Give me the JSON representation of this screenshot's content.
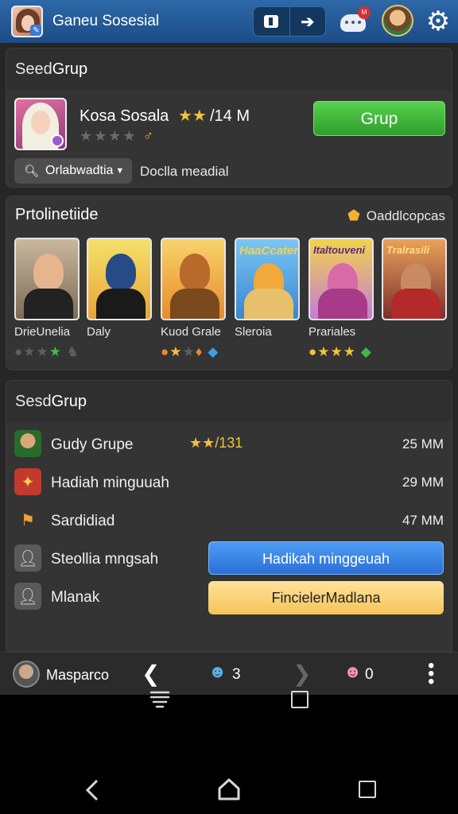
{
  "header": {
    "title": "Ganeu Sosesial",
    "chat_badge": "M",
    "icons": [
      "profile-avatar",
      "toggle-box",
      "arrow-right",
      "chat-bubble",
      "user-avatar",
      "gear"
    ]
  },
  "section1": {
    "heading_pre": "Seed ",
    "heading_main": "Grup",
    "profile_name": "Kosa Sosala",
    "stars": "★★",
    "count": "/14 M",
    "rating": "★★★★",
    "rating_accent": "♂",
    "join_button": "Grup",
    "dropdown_label": "Orlabwadtia",
    "link_text": "Doclla meadial"
  },
  "section2": {
    "title": "Prtolinetiide",
    "right_label": "Oaddlcopcas",
    "tiles": [
      {
        "label": "DrieUnelia"
      },
      {
        "label": "Daly"
      },
      {
        "label": "Kuod Grale"
      },
      {
        "label": "Sleroia"
      },
      {
        "label": "Prariales"
      },
      {
        "label": ""
      }
    ],
    "tile_texts": [
      "",
      "",
      "",
      "HaaCcater",
      "Italtouveni",
      "Tralrasili"
    ]
  },
  "section3": {
    "heading_pre": "Sesd ",
    "heading_main": "Grup",
    "rows": [
      {
        "label": "Gudy Grupe",
        "mid": "★★/131",
        "value": "25 MM"
      },
      {
        "label": "Hadiah minguuah",
        "value": "29 MM"
      },
      {
        "label": "Sardidiad",
        "value": "47 MM"
      },
      {
        "label": "Steollia mngsah",
        "button": "Hadikah minggeuah"
      },
      {
        "label": "Mlanak",
        "button": "FincielerMadlana"
      }
    ]
  },
  "bottombar": {
    "name": "Masparco",
    "count_left": "3",
    "count_right": "0"
  },
  "colors": {
    "header": "#2d68a8",
    "green": "#3fb94a",
    "blue": "#2a6fd6",
    "yellow": "#f6c45a"
  }
}
